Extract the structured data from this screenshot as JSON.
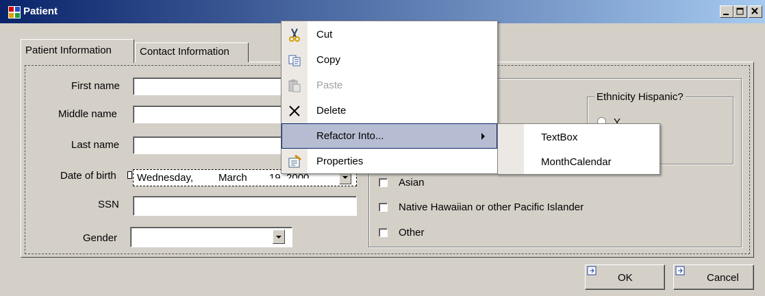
{
  "window": {
    "title": "Patient"
  },
  "tabs": [
    {
      "label": "Patient Information",
      "active": true
    },
    {
      "label": "Contact Information",
      "active": false
    }
  ],
  "form": {
    "first_name": {
      "label": "First name",
      "value": ""
    },
    "middle_name": {
      "label": "Middle name",
      "value": ""
    },
    "last_name": {
      "label": "Last name",
      "value": ""
    },
    "dob": {
      "label": "Date of birth",
      "weekday": "Wednesday,",
      "month": "March",
      "day_year": "19, 2000"
    },
    "ssn": {
      "label": "SSN",
      "value": ""
    },
    "gender": {
      "label": "Gender",
      "value": ""
    }
  },
  "race": {
    "options": [
      "Asian",
      "Native Hawaiian or other Pacific Islander",
      "Other"
    ]
  },
  "ethnicity": {
    "title": "Ethnicity Hispanic?",
    "partial_option": "Y"
  },
  "buttons": {
    "ok": "OK",
    "cancel": "Cancel"
  },
  "context_menu": {
    "items": [
      {
        "label": "Cut",
        "icon": "scissors-icon",
        "enabled": true
      },
      {
        "label": "Copy",
        "icon": "copy-icon",
        "enabled": true
      },
      {
        "label": "Paste",
        "icon": "paste-icon",
        "enabled": false
      },
      {
        "label": "Delete",
        "icon": "delete-x-icon",
        "enabled": true
      },
      {
        "label": "Refactor Into...",
        "icon": "",
        "enabled": true,
        "highlighted": true,
        "submenu": true
      },
      {
        "label": "Properties",
        "icon": "properties-icon",
        "enabled": true
      }
    ],
    "submenu": [
      "TextBox",
      "MonthCalendar"
    ]
  },
  "colors": {
    "titlebar_start": "#0a246a",
    "titlebar_end": "#a6caf0",
    "menu_highlight": "#b6bdd2",
    "face": "#d4d0c8",
    "disabled_text": "#a0a0a0"
  }
}
